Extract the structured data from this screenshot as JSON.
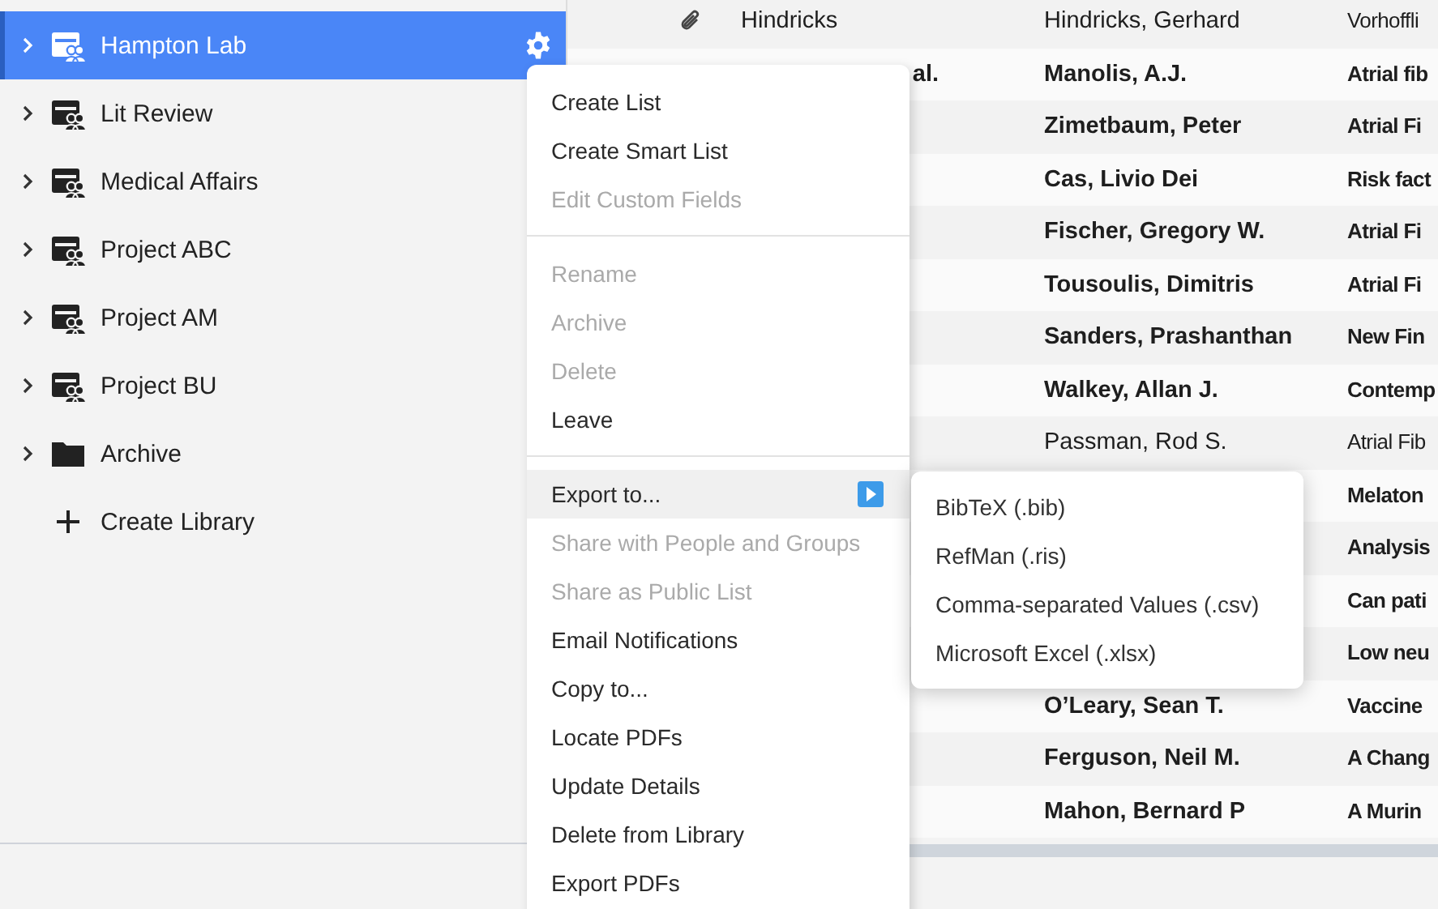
{
  "sidebar": {
    "items": [
      {
        "label": "Hampton Lab",
        "kind": "library",
        "selected": true
      },
      {
        "label": "Lit Review",
        "kind": "library",
        "selected": false
      },
      {
        "label": "Medical Affairs",
        "kind": "library",
        "selected": false
      },
      {
        "label": "Project ABC",
        "kind": "library",
        "selected": false
      },
      {
        "label": "Project AM",
        "kind": "library",
        "selected": false
      },
      {
        "label": "Project BU",
        "kind": "library",
        "selected": false
      },
      {
        "label": "Archive",
        "kind": "folder",
        "selected": false
      },
      {
        "label": "Create Library",
        "kind": "create",
        "selected": false
      }
    ]
  },
  "table": {
    "rows": [
      {
        "attachment": true,
        "title": "Hindricks",
        "title_cut": false,
        "author": "Hindricks, Gerhard",
        "column_4": "Vorhoffli",
        "unread": false
      },
      {
        "attachment": false,
        "title": "al.",
        "title_cut": true,
        "author": "Manolis, A.J.",
        "column_4": "Atrial fib",
        "unread": true
      },
      {
        "attachment": false,
        "title": "",
        "title_cut": false,
        "author": "Zimetbaum, Peter",
        "column_4": "Atrial Fi",
        "unread": true
      },
      {
        "attachment": false,
        "title": "",
        "title_cut": false,
        "author": "Cas, Livio Dei",
        "column_4": "Risk fact",
        "unread": true
      },
      {
        "attachment": false,
        "title": "",
        "title_cut": false,
        "author": "Fischer, Gregory W.",
        "column_4": "Atrial Fi",
        "unread": true
      },
      {
        "attachment": false,
        "title": "",
        "title_cut": false,
        "author": "Tousoulis, Dimitris",
        "column_4": "Atrial Fi",
        "unread": true
      },
      {
        "attachment": false,
        "title": "",
        "title_cut": false,
        "author": "Sanders, Prashanthan",
        "column_4": "New Fin",
        "unread": true
      },
      {
        "attachment": false,
        "title": "",
        "title_cut": false,
        "author": "Walkey, Allan J.",
        "column_4": "Contemp",
        "unread": true
      },
      {
        "attachment": false,
        "title": "",
        "title_cut": false,
        "author": "Passman, Rod S.",
        "column_4": "Atrial Fib",
        "unread": false
      },
      {
        "attachment": false,
        "title": "",
        "title_cut": false,
        "author": "",
        "column_4": "Melaton",
        "unread": true
      },
      {
        "attachment": false,
        "title": "",
        "title_cut": false,
        "author": "",
        "column_4": "Analysis",
        "unread": true
      },
      {
        "attachment": false,
        "title": "",
        "title_cut": false,
        "author": "",
        "column_4": "Can pati",
        "unread": true
      },
      {
        "attachment": false,
        "title": "",
        "title_cut": false,
        "author": "",
        "column_4": "Low neu",
        "unread": true
      },
      {
        "attachment": false,
        "title": "",
        "title_cut": false,
        "author": "O’Leary, Sean T.",
        "column_4": "Vaccine",
        "unread": true
      },
      {
        "attachment": false,
        "title": "",
        "title_cut": false,
        "author": "Ferguson, Neil M.",
        "column_4": "A Chang",
        "unread": true
      },
      {
        "attachment": false,
        "title": "",
        "title_cut": false,
        "author": "Mahon, Bernard P",
        "column_4": "A Murin",
        "unread": true
      }
    ]
  },
  "context_menu": {
    "items": [
      {
        "kind": "item",
        "label": "Create List",
        "disabled": false,
        "hovered": false,
        "submenu": false
      },
      {
        "kind": "item",
        "label": "Create Smart List",
        "disabled": false,
        "hovered": false,
        "submenu": false
      },
      {
        "kind": "item",
        "label": "Edit Custom Fields",
        "disabled": true,
        "hovered": false,
        "submenu": false
      },
      {
        "kind": "separator"
      },
      {
        "kind": "item",
        "label": "Rename",
        "disabled": true,
        "hovered": false,
        "submenu": false
      },
      {
        "kind": "item",
        "label": "Archive",
        "disabled": true,
        "hovered": false,
        "submenu": false
      },
      {
        "kind": "item",
        "label": "Delete",
        "disabled": true,
        "hovered": false,
        "submenu": false
      },
      {
        "kind": "item",
        "label": "Leave",
        "disabled": false,
        "hovered": false,
        "submenu": false
      },
      {
        "kind": "separator"
      },
      {
        "kind": "item",
        "label": "Export to...",
        "disabled": false,
        "hovered": true,
        "submenu": true
      },
      {
        "kind": "item",
        "label": "Share with People and Groups",
        "disabled": true,
        "hovered": false,
        "submenu": false
      },
      {
        "kind": "item",
        "label": "Share as Public List",
        "disabled": true,
        "hovered": false,
        "submenu": false
      },
      {
        "kind": "item",
        "label": "Email Notifications",
        "disabled": false,
        "hovered": false,
        "submenu": false
      },
      {
        "kind": "item",
        "label": "Copy to...",
        "disabled": false,
        "hovered": false,
        "submenu": false
      },
      {
        "kind": "item",
        "label": "Locate PDFs",
        "disabled": false,
        "hovered": false,
        "submenu": false
      },
      {
        "kind": "item",
        "label": "Update Details",
        "disabled": false,
        "hovered": false,
        "submenu": false
      },
      {
        "kind": "item",
        "label": "Delete from Library",
        "disabled": false,
        "hovered": false,
        "submenu": false
      },
      {
        "kind": "item",
        "label": "Export PDFs",
        "disabled": false,
        "hovered": false,
        "submenu": false
      }
    ]
  },
  "submenu": {
    "items": [
      {
        "label": "BibTeX (.bib)"
      },
      {
        "label": "RefMan (.ris)"
      },
      {
        "label": "Comma-separated Values (.csv)"
      },
      {
        "label": "Microsoft Excel (.xlsx)"
      }
    ]
  }
}
